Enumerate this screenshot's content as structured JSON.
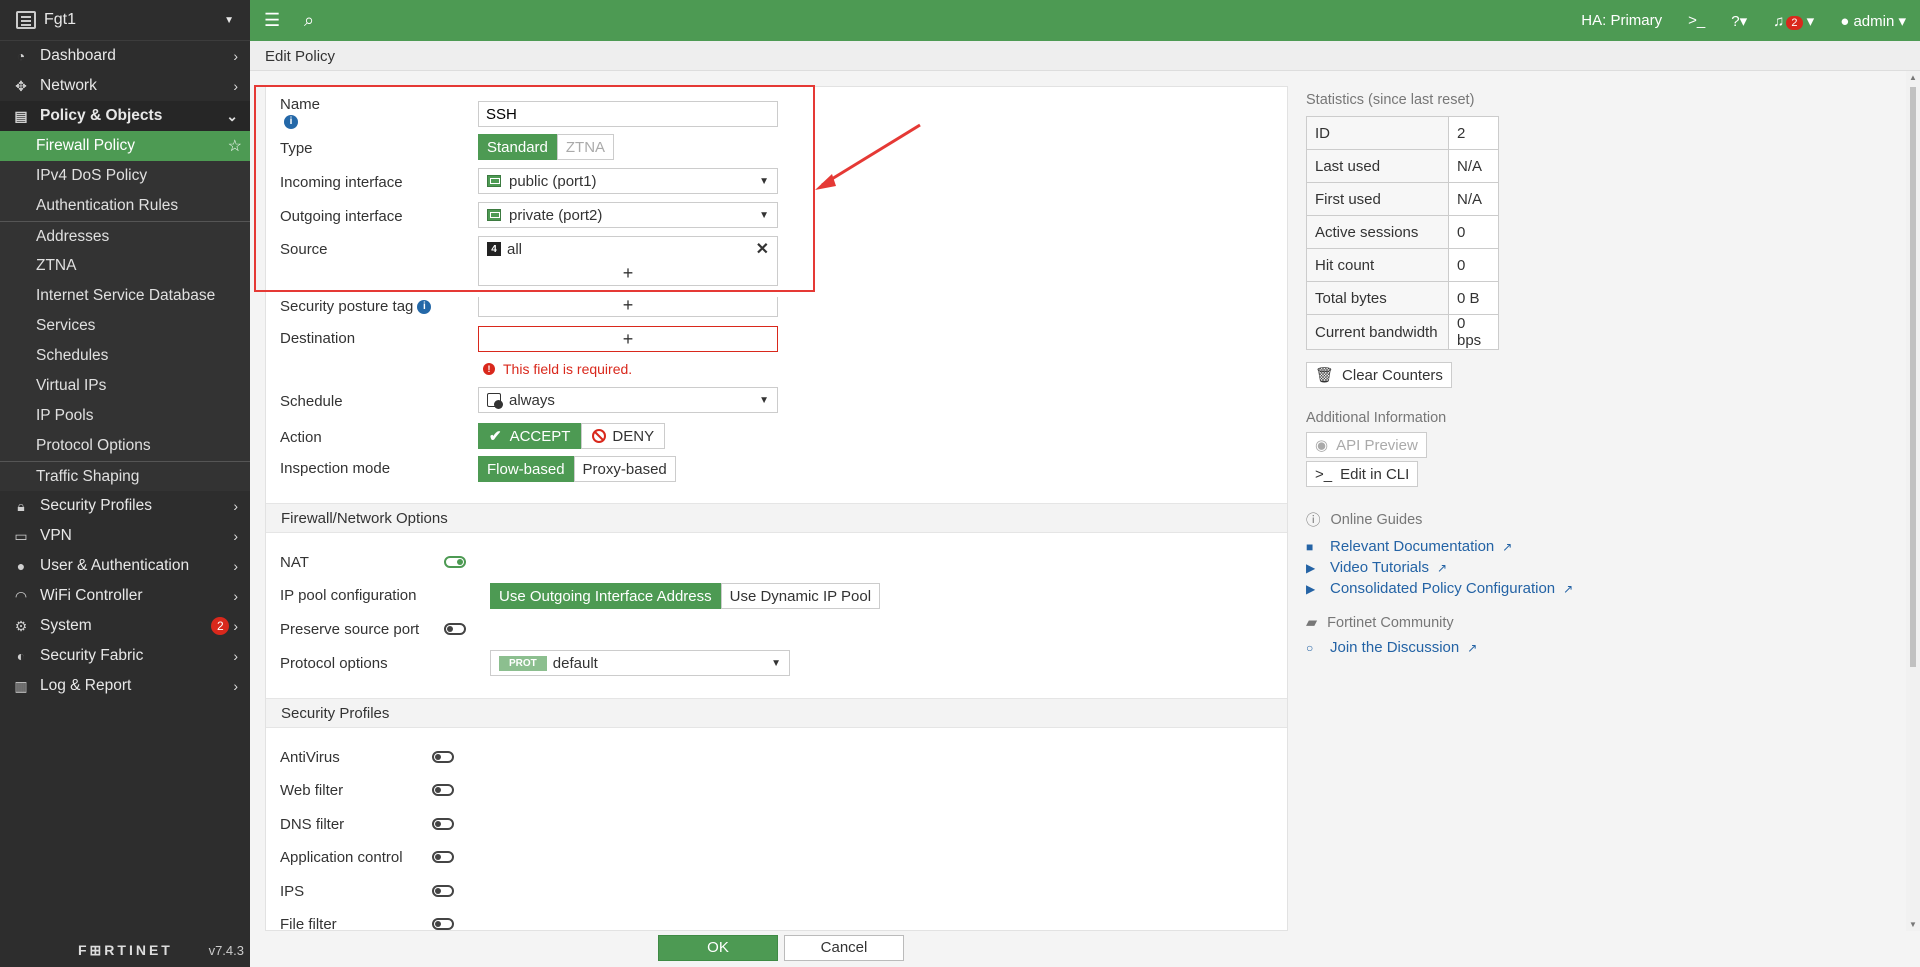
{
  "device": {
    "name": "Fgt1"
  },
  "sidebar": {
    "items": [
      {
        "label": "Dashboard"
      },
      {
        "label": "Network"
      },
      {
        "label": "Policy & Objects"
      },
      {
        "label": "Security Profiles"
      },
      {
        "label": "VPN"
      },
      {
        "label": "User & Authentication"
      },
      {
        "label": "WiFi Controller"
      },
      {
        "label": "System",
        "badge": "2"
      },
      {
        "label": "Security Fabric"
      },
      {
        "label": "Log & Report"
      }
    ],
    "sub_items": [
      {
        "label": "Firewall Policy"
      },
      {
        "label": "IPv4 DoS Policy"
      },
      {
        "label": "Authentication Rules"
      },
      {
        "label": "Addresses"
      },
      {
        "label": "ZTNA"
      },
      {
        "label": "Internet Service Database"
      },
      {
        "label": "Services"
      },
      {
        "label": "Schedules"
      },
      {
        "label": "Virtual IPs"
      },
      {
        "label": "IP Pools"
      },
      {
        "label": "Protocol Options"
      },
      {
        "label": "Traffic Shaping"
      }
    ],
    "footer": {
      "logo": "F⊞RTINET",
      "version": "v7.4.3"
    }
  },
  "topbar": {
    "ha": "HA: Primary",
    "notif_count": "2",
    "user": "admin"
  },
  "page": {
    "title": "Edit Policy"
  },
  "form": {
    "name_label": "Name",
    "name_value": "SSH",
    "type_label": "Type",
    "type_standard": "Standard",
    "type_ztna": "ZTNA",
    "incoming_label": "Incoming interface",
    "incoming_value": "public (port1)",
    "outgoing_label": "Outgoing interface",
    "outgoing_value": "private (port2)",
    "source_label": "Source",
    "source_value": "all",
    "posture_label": "Security posture tag",
    "destination_label": "Destination",
    "destination_error": "This field is required.",
    "schedule_label": "Schedule",
    "schedule_value": "always",
    "action_label": "Action",
    "action_accept": "ACCEPT",
    "action_deny": "DENY",
    "inspection_label": "Inspection mode",
    "inspection_flow": "Flow-based",
    "inspection_proxy": "Proxy-based"
  },
  "firewall_options": {
    "title": "Firewall/Network Options",
    "nat_label": "NAT",
    "nat_enabled": true,
    "ippool_label": "IP pool configuration",
    "ippool_outgoing": "Use Outgoing Interface Address",
    "ippool_dynamic": "Use Dynamic IP Pool",
    "preserve_label": "Preserve source port",
    "protocol_label": "Protocol options",
    "protocol_tag": "PROT",
    "protocol_value": "default"
  },
  "security_profiles": {
    "title": "Security Profiles",
    "items": [
      {
        "label": "AntiVirus"
      },
      {
        "label": "Web filter"
      },
      {
        "label": "DNS filter"
      },
      {
        "label": "Application control"
      },
      {
        "label": "IPS"
      },
      {
        "label": "File filter"
      }
    ]
  },
  "buttons": {
    "ok": "OK",
    "cancel": "Cancel"
  },
  "statistics": {
    "title": "Statistics (since last reset)",
    "rows": [
      {
        "k": "ID",
        "v": "2"
      },
      {
        "k": "Last used",
        "v": "N/A"
      },
      {
        "k": "First used",
        "v": "N/A"
      },
      {
        "k": "Active sessions",
        "v": "0"
      },
      {
        "k": "Hit count",
        "v": "0"
      },
      {
        "k": "Total bytes",
        "v": "0 B"
      },
      {
        "k": "Current bandwidth",
        "v": "0 bps"
      }
    ],
    "clear_btn": "Clear Counters"
  },
  "additional": {
    "title": "Additional Information",
    "api_preview": "API Preview",
    "edit_cli": "Edit in CLI"
  },
  "guides": {
    "title": "Online Guides",
    "links": [
      {
        "label": "Relevant Documentation"
      },
      {
        "label": "Video Tutorials"
      },
      {
        "label": "Consolidated Policy Configuration"
      }
    ]
  },
  "community": {
    "title": "Fortinet Community",
    "link": "Join the Discussion"
  },
  "colors": {
    "accent": "#4d9a53",
    "error": "#d9281c",
    "link": "#2463a5",
    "sidebar": "#2d2d2d"
  }
}
